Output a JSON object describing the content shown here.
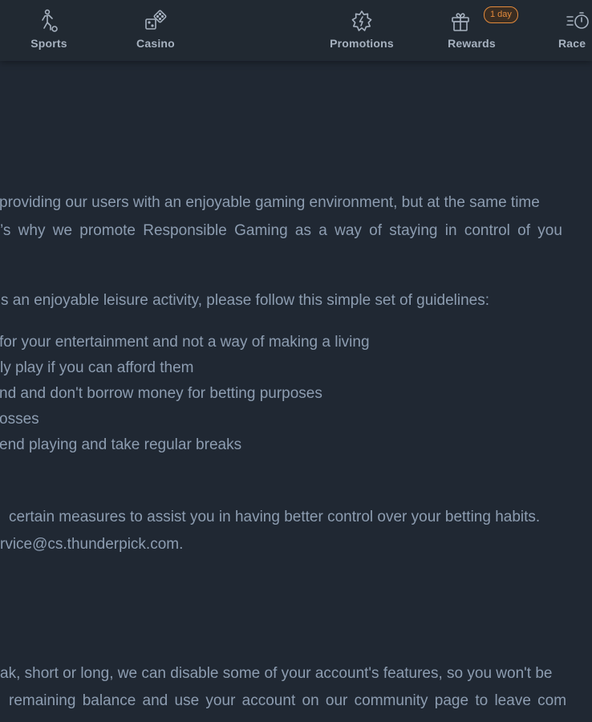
{
  "nav": {
    "items": [
      {
        "label": "Sports",
        "icon": "soccer-player-icon"
      },
      {
        "label": "Casino",
        "icon": "dice-icon"
      },
      {
        "label": "Promotions",
        "icon": "promotion-starburst-icon"
      },
      {
        "label": "Rewards",
        "icon": "gift-icon",
        "badge": "1 day"
      },
      {
        "label": "Race",
        "icon": "race-stopwatch-icon"
      }
    ]
  },
  "content": {
    "intro_line1": "providing our users with an enjoyable gaming environment, but at the same time",
    "intro_line2": "’s why we promote Responsible Gaming as a way of staying in control of you",
    "guidelines_intro": "s an enjoyable leisure activity, please follow this simple set of guidelines:",
    "guidelines": [
      "for your entertainment and not a way of making a living",
      "ly play if you can afford them",
      "nd and don't borrow money for betting purposes",
      "osses",
      "end playing and take regular breaks"
    ],
    "measures_line1": "certain measures to assist you in having better control over your betting habits.",
    "measures_line2": "rvice@cs.thunderpick.com.",
    "break_line1": "ak, short or long, we can disable some of your account's features, so you won't be",
    "break_line2": "remaining balance and use your account on our community page to leave com"
  },
  "colors": {
    "background": "#202833",
    "nav_background": "#212932",
    "text": "#8d9db1",
    "nav_text": "#a7b2c0",
    "badge": "#e38a3c"
  }
}
